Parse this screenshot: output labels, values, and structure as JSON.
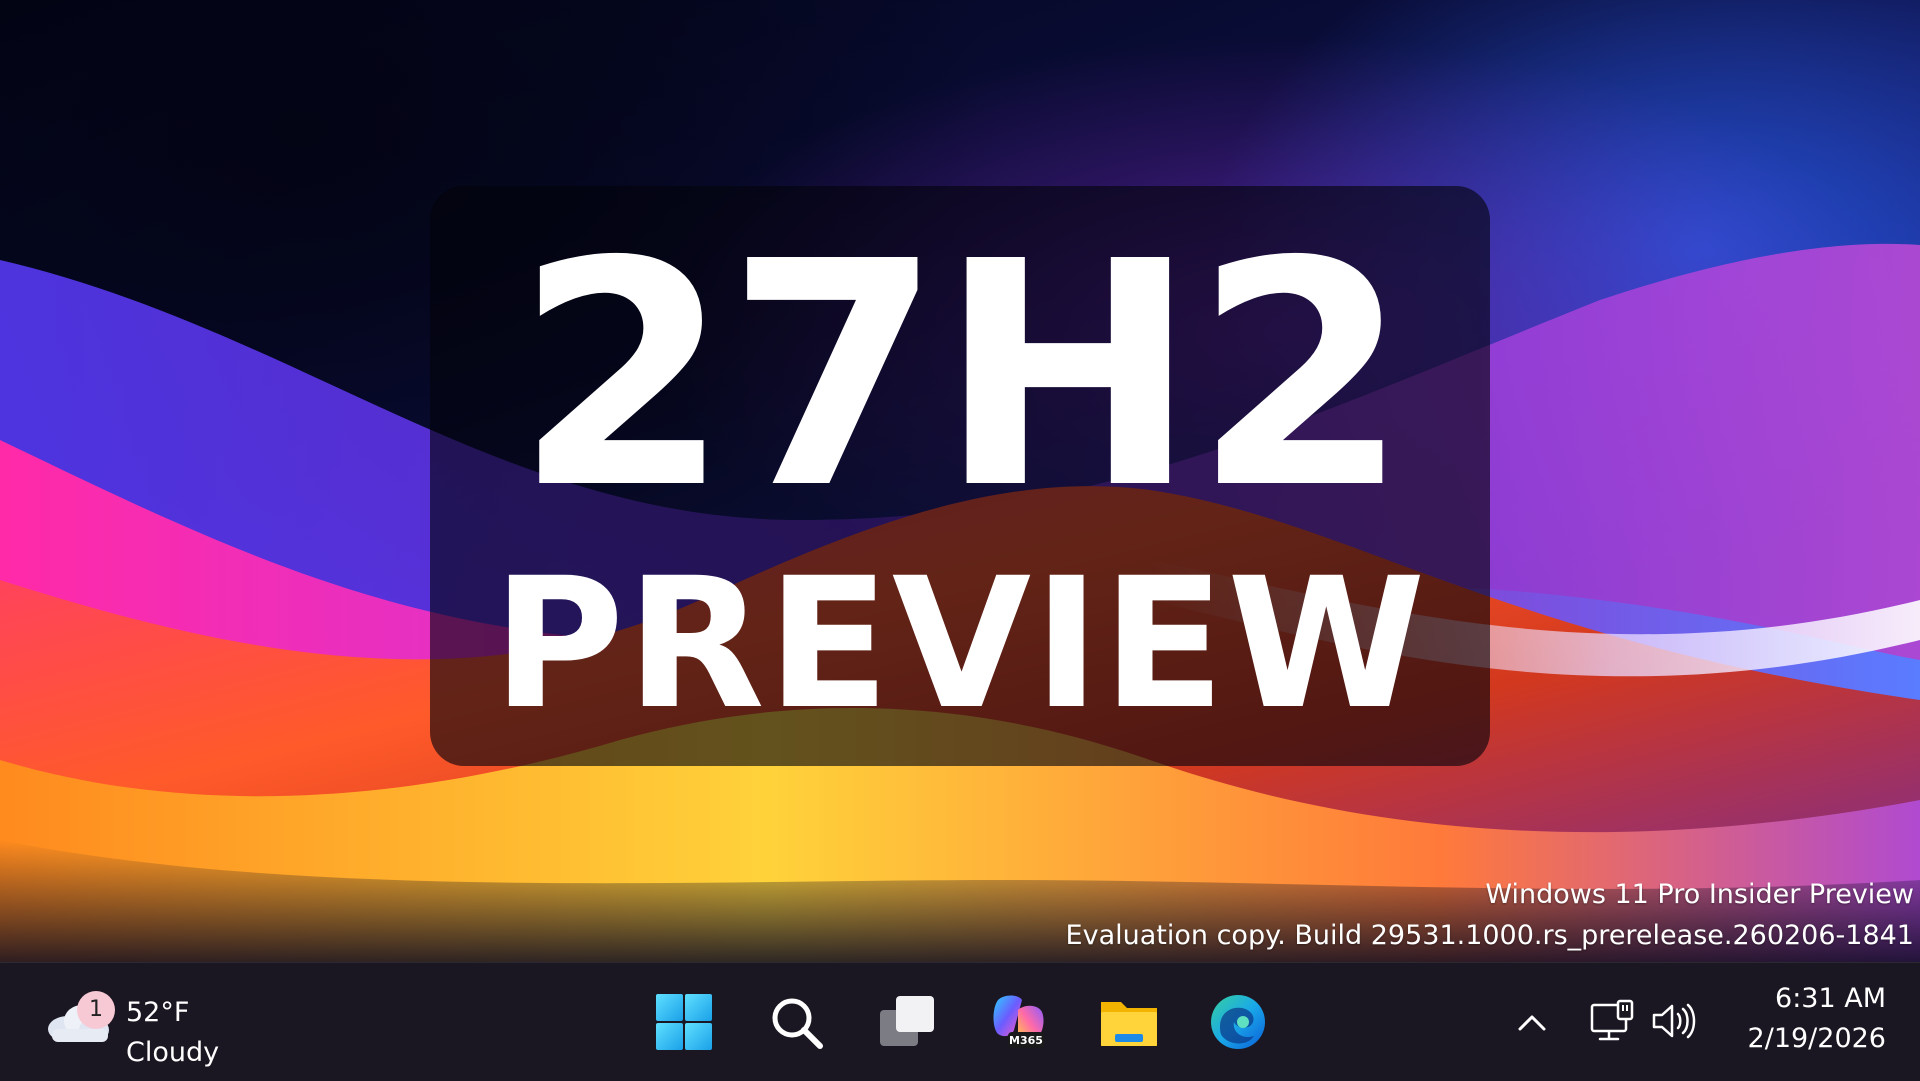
{
  "hero": {
    "line1": "27H2",
    "line2": "PREVIEW"
  },
  "watermark": {
    "edition": "Windows 11 Pro Insider Preview",
    "build": "Evaluation copy. Build 29531.1000.rs_prerelease.260206-1841"
  },
  "taskbar": {
    "weather": {
      "icon": "cloud-icon",
      "notification_count": "1",
      "temperature": "52°F",
      "condition": "Cloudy"
    },
    "apps": [
      {
        "name": "start-button",
        "icon": "windows-logo-icon"
      },
      {
        "name": "search-button",
        "icon": "search-icon"
      },
      {
        "name": "task-view-button",
        "icon": "task-view-icon"
      },
      {
        "name": "copilot-m365-app",
        "icon": "copilot-icon",
        "badge": "M365"
      },
      {
        "name": "file-explorer-app",
        "icon": "folder-icon"
      },
      {
        "name": "edge-app",
        "icon": "edge-icon"
      }
    ],
    "tray": {
      "icons": [
        "chevron-up-icon",
        "network-icon",
        "volume-icon"
      ]
    },
    "clock": {
      "time": "6:31 AM",
      "date": "2/19/2026"
    }
  },
  "colors": {
    "accent": "#0078d4",
    "taskbar_bg": "#1c1822",
    "badge_bg": "#f7c9d4"
  }
}
